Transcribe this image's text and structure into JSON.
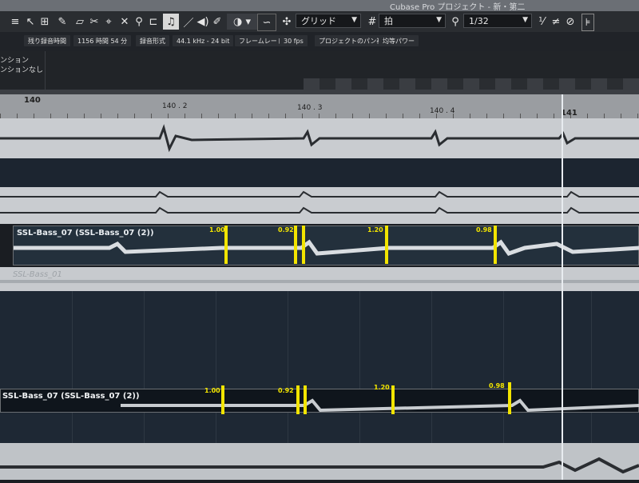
{
  "window": {
    "title": "Cubase Pro プロジェクト - 新・第二"
  },
  "toolbar": {
    "grid_type": "グリッド",
    "snap_mode": "拍",
    "quantize": "1/32",
    "snap_icon": "grid-icon",
    "hash_icon": "hash-icon",
    "search_icon": "search-icon"
  },
  "info": {
    "remaining_label": "残り録音時間",
    "remaining_value": "1156 時間 54 分",
    "format_label": "録音形式",
    "format_value": "44.1 kHz - 24 bit",
    "framerate_label": "フレームレート",
    "framerate_value": "30 fps",
    "pan_label": "プロジェクトのパン補正",
    "power_label": "均等パワー"
  },
  "inspector": {
    "top": "ンション",
    "value": "ンションなし"
  },
  "ruler": {
    "labels": [
      "140",
      "140 . 2",
      "140 . 3",
      "140 . 4",
      "141"
    ]
  },
  "tracks": {
    "clip_upper": "SSL-Bass_07 (SSL-Bass_07 (2))",
    "clip_ghost": "SSL-Bass_01",
    "clip_lower": "SSL-Bass_07 (SSL-Bass_07 (2))"
  },
  "warp_markers_upper": [
    "1.00",
    "0.92",
    "1.20",
    "0.98"
  ],
  "warp_markers_lower": [
    "1.00",
    "0.92",
    "1.20",
    "0.98"
  ],
  "colors": {
    "marker": "#f2e400",
    "clip_bg": "#d8dadd",
    "lane_dark": "#1c2530"
  }
}
